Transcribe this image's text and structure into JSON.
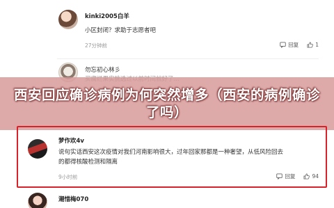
{
  "comments": [
    {
      "username": "kinki2005白羊",
      "text": "小区封闭？求助于志愿者吧",
      "time": "27分钟前",
      "reply_label": "回复",
      "like_count": "1"
    },
    {
      "username": "勿忘初心林彡",
      "text": "买腐烂果实挑选过以前时间就好了…",
      "time": "",
      "reply_label": "",
      "like_count": ""
    },
    {
      "username": "梦作欢4v",
      "text_line1": "说句实话西安这次疫情对我们河南影响很大，过年回家那都是一种奢望，从低风险回去",
      "text_line2": "的都得核酸检测和隔离",
      "time": "9小时前",
      "reply_label": "回复",
      "like_count": "94"
    },
    {
      "username": "潮惜梅070"
    }
  ],
  "banner": {
    "title": "西安回应确诊病例为何突然增多（西安的病例确诊了吗）"
  },
  "colors": {
    "highlight_border": "#d8222a",
    "banner_overlay": "#d69696"
  }
}
